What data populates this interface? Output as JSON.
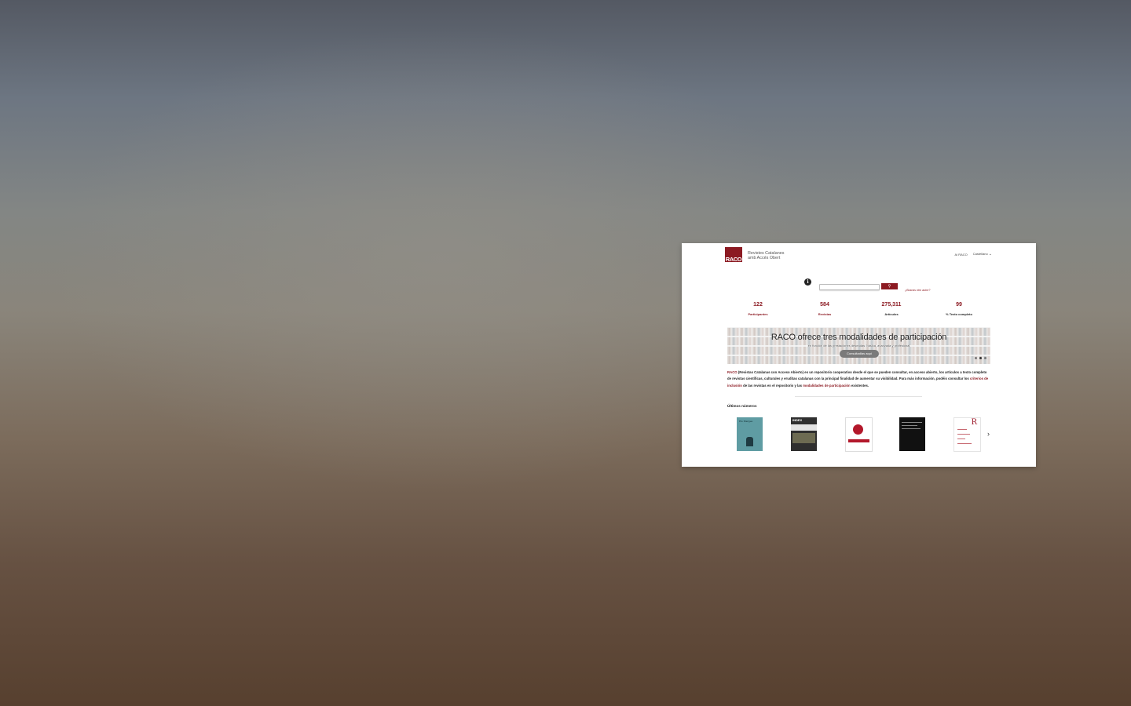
{
  "header": {
    "logo_text": "RACO",
    "site_name_line1": "Revistes Catalanes",
    "site_name_line2": "amb Accés Obert",
    "nav_about": "Al RACO",
    "language": "Castellano"
  },
  "search": {
    "link": "¿Buscas otro autor?"
  },
  "stats": [
    {
      "value": "122",
      "label": "Participantes"
    },
    {
      "value": "584",
      "label": "Revistas"
    },
    {
      "value": "275,311",
      "label": "Artículos"
    },
    {
      "value": "99",
      "label": "% Texto completo"
    }
  ],
  "banner": {
    "title": "RACO ofrece tres modalidades de participación",
    "subtitle": "en función de las prestaciones deseadas: básica, avanzada y profesional",
    "button": "Consultadlas aquí"
  },
  "description": {
    "raco": "RACO",
    "p1": " (Revistas Catalanas con Acceso Abierto) es un repositorio cooperativo desde el que se pueden consultar, en acceso abierto, los artículos a texto completo de revistas científicas, culturales y eruditas catalanas con la principal finalidad de aumentar su visibilidad. Para más información, podéis consultar los ",
    "link1": "criterios de inclusión",
    "p2": " de las revistas en el repositorio y las ",
    "link2": "modalidades de participación",
    "p3": " existentes."
  },
  "latest": {
    "heading": "Últimos números",
    "cover1_title": "Els Marges",
    "cover2_title": "INDEX"
  },
  "colors": {
    "accent": "#8c1a22"
  }
}
